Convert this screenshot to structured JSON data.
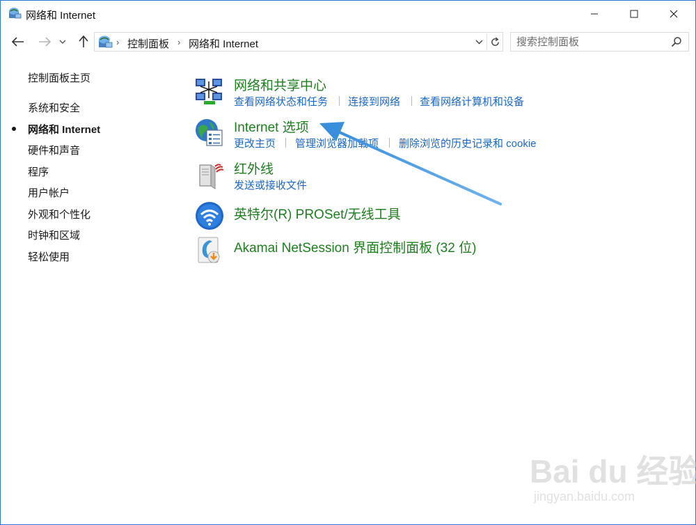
{
  "window": {
    "title": "网络和 Internet",
    "controls": {
      "minimize": "minimize-icon",
      "maximize": "maximize-icon",
      "close": "close-icon"
    }
  },
  "navigation": {
    "back": "back-arrow-icon",
    "forward": "forward-arrow-icon",
    "recent": "chevron-down-icon",
    "up": "up-arrow-icon"
  },
  "address_bar": {
    "crumbs": [
      "控制面板",
      "网络和 Internet"
    ],
    "separator": "›"
  },
  "search": {
    "placeholder": "搜索控制面板"
  },
  "left_nav": {
    "items": [
      {
        "label": "控制面板主页",
        "current": false
      },
      {
        "label": "系统和安全",
        "current": false
      },
      {
        "label": "网络和 Internet",
        "current": true
      },
      {
        "label": "硬件和声音",
        "current": false
      },
      {
        "label": "程序",
        "current": false
      },
      {
        "label": "用户帐户",
        "current": false
      },
      {
        "label": "外观和个性化",
        "current": false
      },
      {
        "label": "时钟和区域",
        "current": false
      },
      {
        "label": "轻松使用",
        "current": false
      }
    ]
  },
  "categories": [
    {
      "title": "网络和共享中心",
      "icon": "network-center-icon",
      "tasks": [
        "查看网络状态和任务",
        "连接到网络",
        "查看网络计算机和设备"
      ]
    },
    {
      "title": "Internet 选项",
      "icon": "internet-options-icon",
      "tasks": [
        "更改主页",
        "管理浏览器加载项",
        "删除浏览的历史记录和 cookie"
      ]
    },
    {
      "title": "红外线",
      "icon": "infrared-icon",
      "tasks": [
        "发送或接收文件"
      ]
    },
    {
      "title": "英特尔(R) PROSet/无线工具",
      "icon": "wireless-tool-icon",
      "tasks": []
    },
    {
      "title": "Akamai NetSession 界面控制面板 (32 位)",
      "icon": "akamai-icon",
      "tasks": []
    }
  ],
  "annotation": {
    "arrow_color": "#3a8fdc",
    "target": "Internet 选项"
  },
  "watermark": {
    "brand": "Bai du 经验",
    "url": "jingyan.baidu.com"
  },
  "colors": {
    "category_title": "#1e7f1e",
    "task_link": "#1b67c6",
    "window_border": "#2b78d4"
  }
}
